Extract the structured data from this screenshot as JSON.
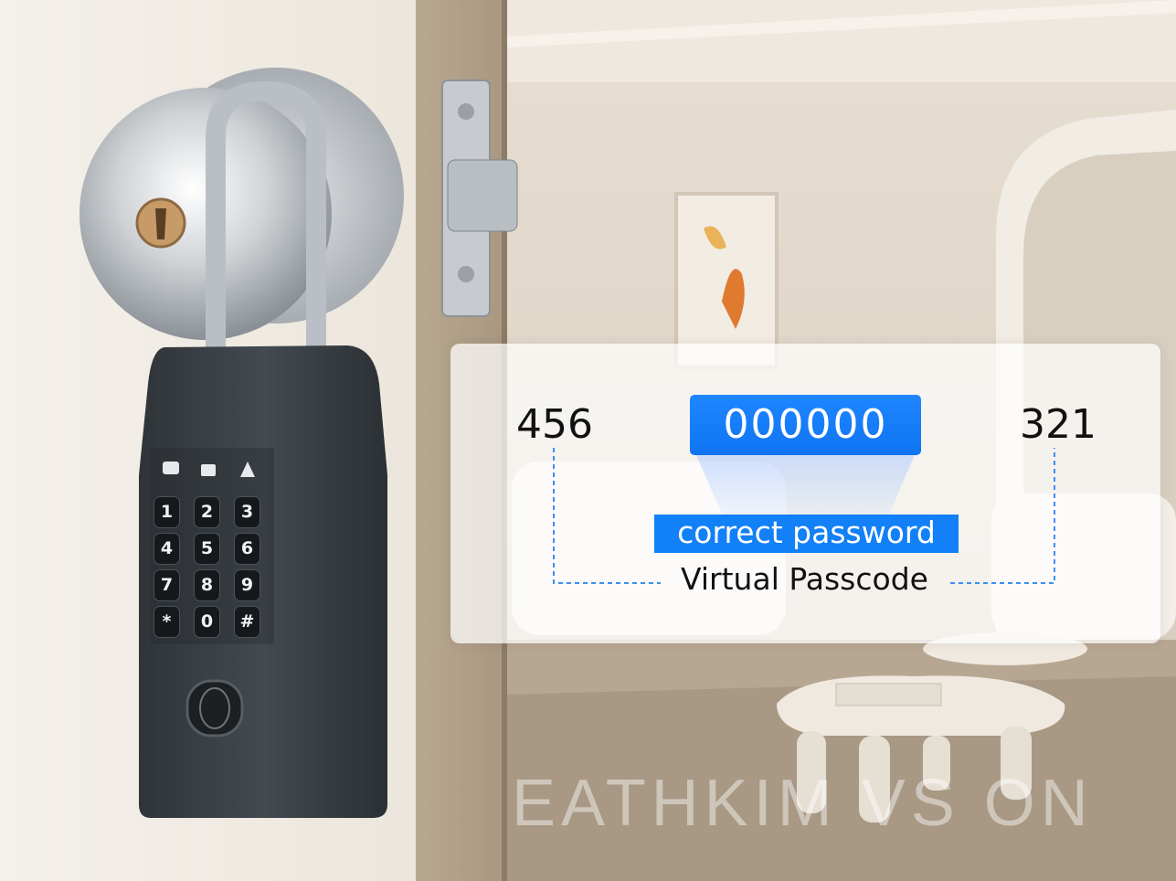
{
  "overlay": {
    "left_digits": "456",
    "code": "000000",
    "right_digits": "321",
    "status": "correct password",
    "caption": "Virtual Passcode"
  },
  "keypad": {
    "keys": [
      "1",
      "2",
      "3",
      "4",
      "5",
      "6",
      "7",
      "8",
      "9",
      "*",
      "0",
      "#"
    ]
  },
  "watermark": "EATHKIM VS ON",
  "colors": {
    "accent_blue": "#1280f6",
    "lockbox_body": "#3b4046",
    "panel_bg": "#ffffff"
  }
}
